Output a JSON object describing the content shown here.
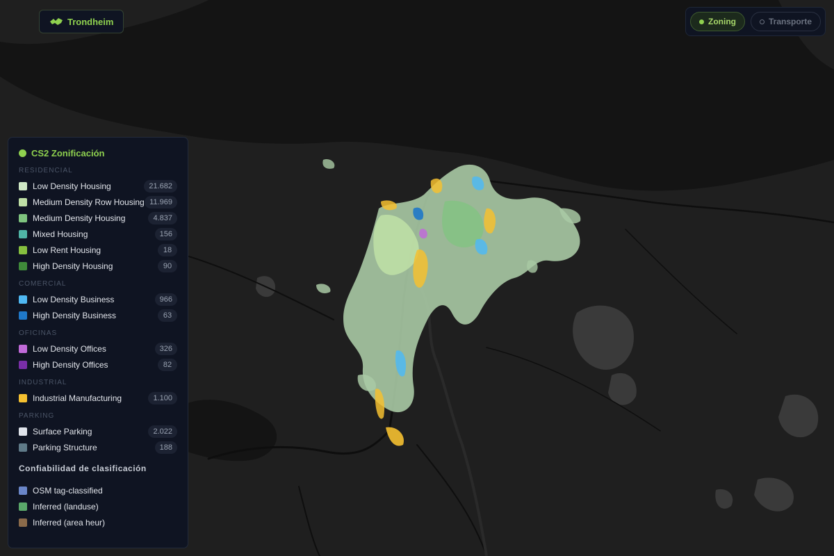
{
  "header": {
    "city_label": "Trondheim",
    "city_icon": "map-pin-icon"
  },
  "modes": [
    {
      "label": "Zoning",
      "active": true
    },
    {
      "label": "Transporte",
      "active": false
    }
  ],
  "legend": {
    "title": "CS2 Zonificación",
    "sections": [
      {
        "title": "RESIDENCIAL",
        "items": [
          {
            "label": "Low Density Housing",
            "count": "21.682",
            "color": "#cfe8c5"
          },
          {
            "label": "Medium Density Row Housing",
            "count": "11.969",
            "color": "#bfe0a6"
          },
          {
            "label": "Medium Density Housing",
            "count": "4.837",
            "color": "#7fc47f"
          },
          {
            "label": "Mixed Housing",
            "count": "156",
            "color": "#4fb5a6"
          },
          {
            "label": "Low Rent Housing",
            "count": "18",
            "color": "#86bf3f"
          },
          {
            "label": "High Density Housing",
            "count": "90",
            "color": "#3f8a3a"
          }
        ]
      },
      {
        "title": "COMERCIAL",
        "items": [
          {
            "label": "Low Density Business",
            "count": "966",
            "color": "#4fb8f2"
          },
          {
            "label": "High Density Business",
            "count": "63",
            "color": "#1f78c8"
          }
        ]
      },
      {
        "title": "OFICINAS",
        "items": [
          {
            "label": "Low Density Offices",
            "count": "326",
            "color": "#c06ad8"
          },
          {
            "label": "High Density Offices",
            "count": "82",
            "color": "#7a2ea8"
          }
        ]
      },
      {
        "title": "INDUSTRIAL",
        "items": [
          {
            "label": "Industrial Manufacturing",
            "count": "1.100",
            "color": "#f5c030"
          }
        ]
      },
      {
        "title": "PARKING",
        "items": [
          {
            "label": "Surface Parking",
            "count": "2.022",
            "color": "#dfe3ea"
          },
          {
            "label": "Parking Structure",
            "count": "188",
            "color": "#5f7a88"
          }
        ]
      }
    ],
    "confidence": {
      "title": "Confiabilidad de clasificación",
      "items": [
        {
          "label": "OSM tag-classified",
          "color": "#6a86c8"
        },
        {
          "label": "Inferred (landuse)",
          "color": "#5aa86a"
        },
        {
          "label": "Inferred (area heur)",
          "color": "#8a6a4a"
        }
      ]
    }
  }
}
